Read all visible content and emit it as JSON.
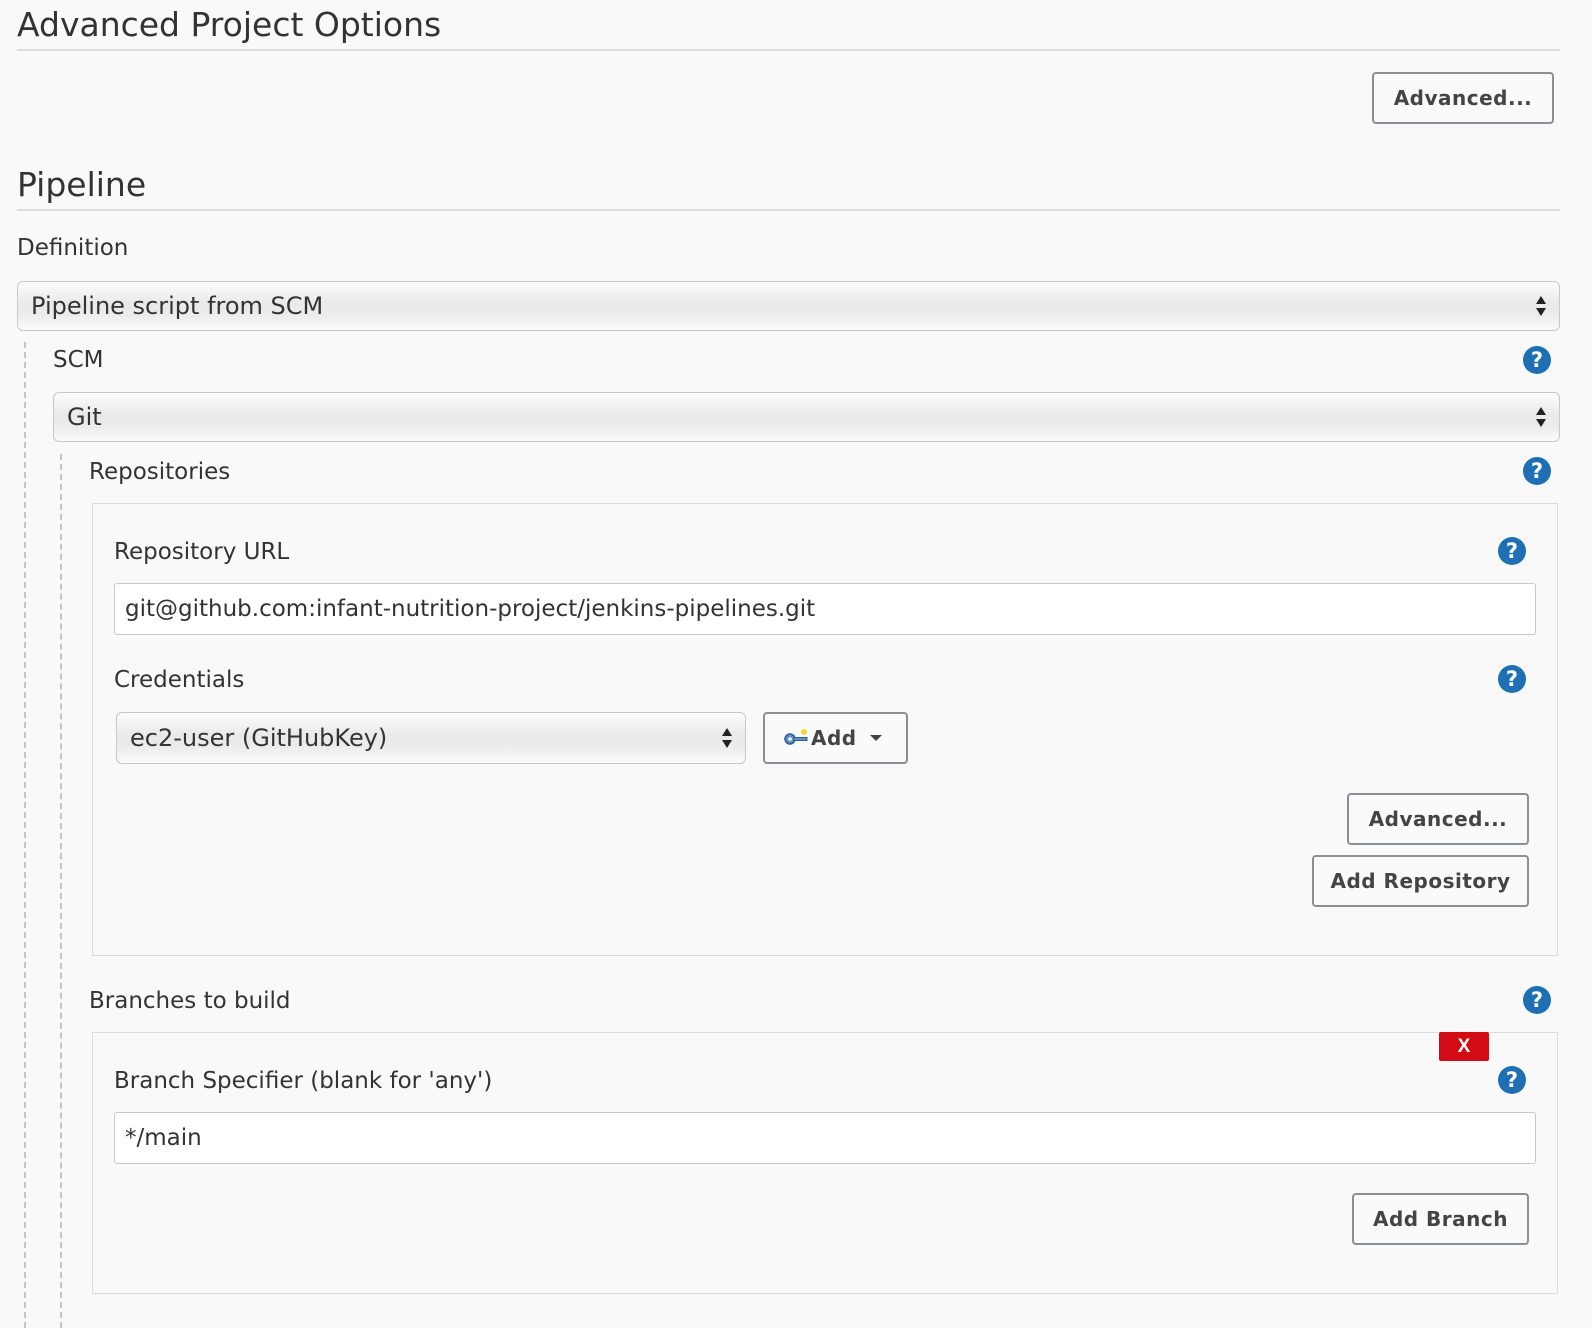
{
  "advanced_options": {
    "title": "Advanced Project Options",
    "advanced_button": "Advanced..."
  },
  "pipeline": {
    "title": "Pipeline",
    "definition_label": "Definition",
    "definition_value": "Pipeline script from SCM",
    "scm_label": "SCM",
    "scm_value": "Git",
    "help_symbol": "?",
    "repositories": {
      "label": "Repositories",
      "url_label": "Repository URL",
      "url_value": "git@github.com:infant-nutrition-project/jenkins-pipelines.git",
      "credentials_label": "Credentials",
      "credentials_value": "ec2-user (GitHubKey)",
      "add_button": "Add",
      "advanced_button": "Advanced...",
      "add_repository_button": "Add Repository"
    },
    "branches": {
      "label": "Branches to build",
      "delete_label": "X",
      "specifier_label": "Branch Specifier (blank for 'any')",
      "specifier_value": "*/main",
      "add_branch_button": "Add Branch"
    }
  },
  "colors": {
    "help_blue": "#1f6fb5",
    "delete_red": "#d30b14"
  },
  "icons": {
    "credentials_add": "key-icon",
    "select_arrows": "updown-arrows-icon",
    "dropdown": "caret-down-icon"
  }
}
